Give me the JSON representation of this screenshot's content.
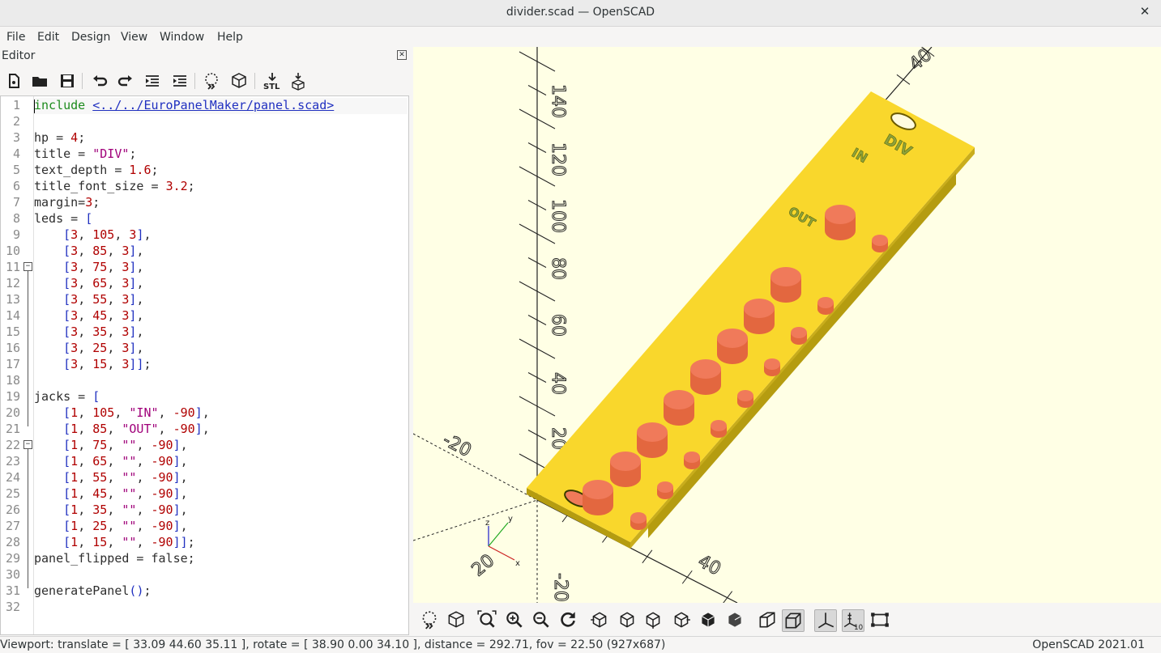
{
  "window": {
    "title": "divider.scad — OpenSCAD",
    "close_glyph": "✕"
  },
  "menu": [
    "File",
    "Edit",
    "Design",
    "View",
    "Window",
    "Help"
  ],
  "editor": {
    "label": "Editor",
    "toolbar_icons": [
      "new-file-icon",
      "open-file-icon",
      "save-icon",
      "undo-icon",
      "redo-icon",
      "unindent-icon",
      "indent-icon",
      "preview-icon",
      "render-icon",
      "export-stl-icon",
      "send-to-printer-icon"
    ],
    "stl_label": "STL",
    "lines": [
      "include <../../EuroPanelMaker/panel.scad>",
      "",
      "hp = 4;",
      "title = \"DIV\";",
      "text_depth = 1.6;",
      "title_font_size = 3.2;",
      "margin=3;",
      "leds = [",
      "    [3, 105, 3],",
      "    [3, 85, 3],",
      "    [3, 75, 3],",
      "    [3, 65, 3],",
      "    [3, 55, 3],",
      "    [3, 45, 3],",
      "    [3, 35, 3],",
      "    [3, 25, 3],",
      "    [3, 15, 3]];",
      "",
      "jacks = [",
      "    [1, 105, \"IN\", -90],",
      "    [1, 85, \"OUT\", -90],",
      "    [1, 75, \"\", -90],",
      "    [1, 65, \"\", -90],",
      "    [1, 55, \"\", -90],",
      "    [1, 45, \"\", -90],",
      "    [1, 35, \"\", -90],",
      "    [1, 25, \"\", -90],",
      "    [1, 15, \"\", -90]];",
      "panel_flipped = false;",
      "",
      "generatePanel();",
      ""
    ]
  },
  "viewport": {
    "background": "#ffffe5",
    "panel_color": "#f9d72c",
    "hole_color": "#f07a5a",
    "panel_texts": [
      "DIV",
      "IN",
      "OUT"
    ],
    "axis_labels": [
      "40",
      "20",
      "40",
      "60",
      "80",
      "100",
      "120",
      "140",
      "-20",
      "-20",
      "20",
      "40"
    ],
    "gizmo_labels": [
      "z",
      "y",
      "x"
    ]
  },
  "viewport_toolbar_icons": [
    "preview-icon",
    "render-icon",
    "view-all-icon",
    "zoom-in-icon",
    "zoom-out-icon",
    "reset-view-icon",
    "view-right-icon",
    "view-top-icon",
    "view-bottom-icon",
    "view-left-icon",
    "view-front-icon",
    "view-back-icon",
    "perspective-icon",
    "orthogonal-icon",
    "show-axes-icon",
    "show-scale-markers-icon",
    "show-edges-icon"
  ],
  "status": {
    "viewport": "Viewport: translate = [ 33.09 44.60 35.11 ], rotate = [ 38.90 0.00 34.10 ], distance = 292.71, fov = 22.50 (927x687)",
    "version": "OpenSCAD 2021.01"
  }
}
